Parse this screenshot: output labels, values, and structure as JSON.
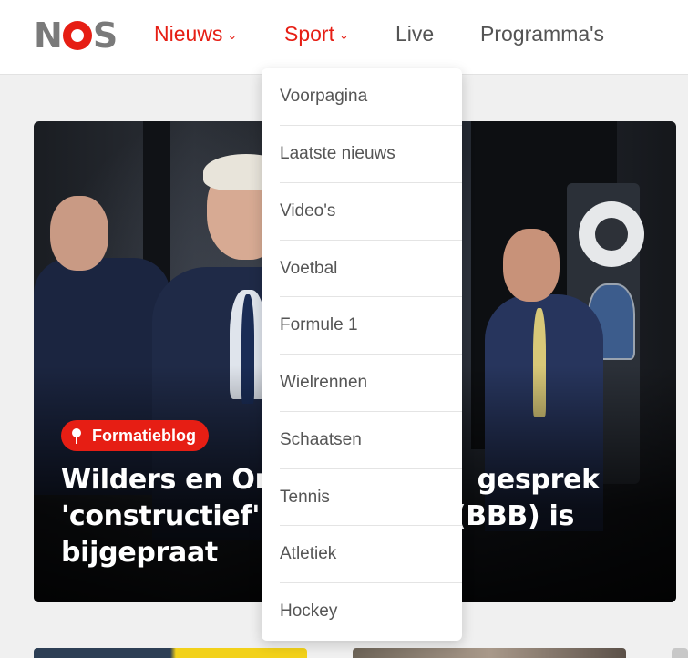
{
  "header": {
    "logo_text": "NOS",
    "nav": [
      {
        "label": "Nieuws",
        "chevron": "⌄",
        "active": true
      },
      {
        "label": "Sport",
        "chevron": "⌄",
        "active": true
      },
      {
        "label": "Live"
      },
      {
        "label": "Programma's"
      }
    ]
  },
  "dropdown": {
    "items": [
      "Voorpagina",
      "Laatste nieuws",
      "Video's",
      "Voetbal",
      "Formule 1",
      "Wielrennen",
      "Schaatsen",
      "Tennis",
      "Atletiek",
      "Hockey"
    ]
  },
  "hero": {
    "badge": "Formatieblog",
    "headline_lines": [
      "Wilders en Om                     gesprek",
      "'constructief' e                  (BBB) is",
      "bijgepraat"
    ]
  },
  "colors": {
    "brand_red": "#e61e14",
    "nav_gray": "#545454",
    "logo_gray": "#7a7a7a"
  }
}
